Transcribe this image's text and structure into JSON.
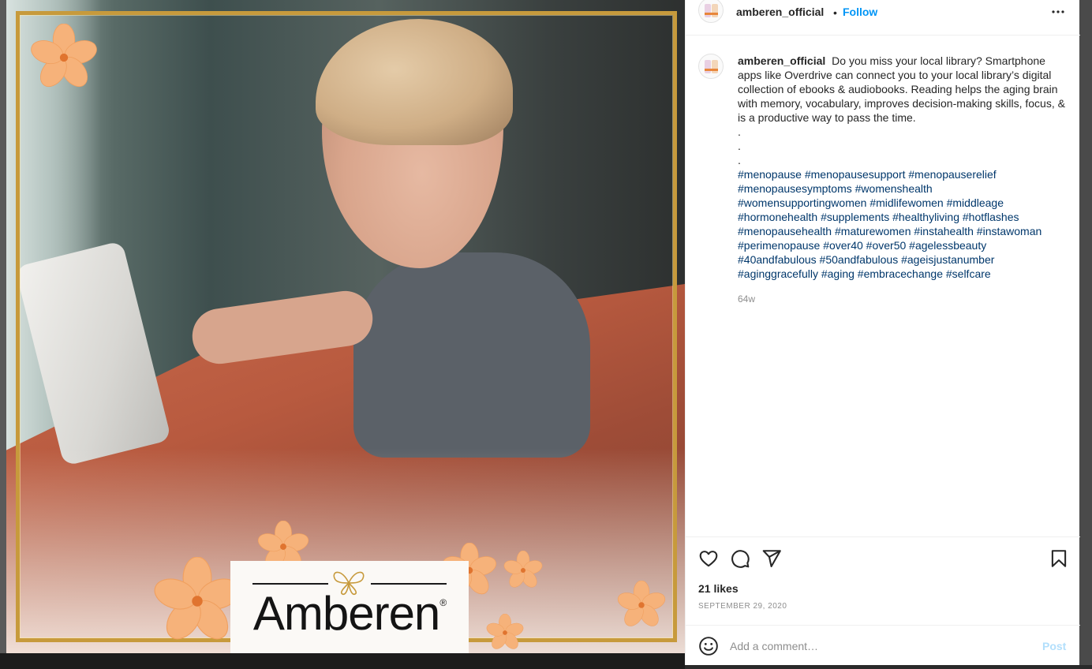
{
  "post": {
    "username": "amberen_official",
    "follow_label": "Follow",
    "dot": "•",
    "caption_text": "Do you miss your local library? Smartphone apps like Overdrive can connect you to your local library’s digital collection of ebooks & audiobooks. Reading helps the aging brain with memory, vocabulary, improves decision-making skills, focus, & is a productive way to pass the time.",
    "dots": [
      ".",
      ".",
      "."
    ],
    "hashtags": [
      "#menopause",
      "#menopausesupport",
      "#menopauserelief",
      "#menopausesymptoms",
      "#womenshealth",
      "#womensupportingwomen",
      "#midlifewomen",
      "#middleage",
      "#hormonehealth",
      "#supplements",
      "#healthyliving",
      "#hotflashes",
      "#menopausehealth",
      "#maturewomen",
      "#instahealth",
      "#instawoman",
      "#perimenopause",
      "#over40",
      "#over50",
      "#agelessbeauty",
      "#40andfabulous",
      "#50andfabulous",
      "#ageisjustanumber",
      "#aginggracefully",
      "#aging",
      "#embracechange",
      "#selfcare"
    ],
    "time_ago": "64w",
    "likes": "21 likes",
    "date": "SEPTEMBER 29, 2020"
  },
  "image": {
    "brand_name": "Amberen",
    "brand_mark": "®"
  },
  "comment": {
    "placeholder": "Add a comment…",
    "post_label": "Post"
  },
  "icons": {
    "more": "more-options-icon",
    "like": "heart-icon",
    "comment": "comment-icon",
    "share": "share-icon",
    "save": "bookmark-icon",
    "emoji": "emoji-icon"
  },
  "colors": {
    "link_blue": "#0095f6",
    "hashtag_blue": "#00376b",
    "muted": "#8e8e8e",
    "post_disabled": "#b2dffc",
    "frame_gold": "#c79a3c",
    "flower_peach": "#f6b27a"
  }
}
